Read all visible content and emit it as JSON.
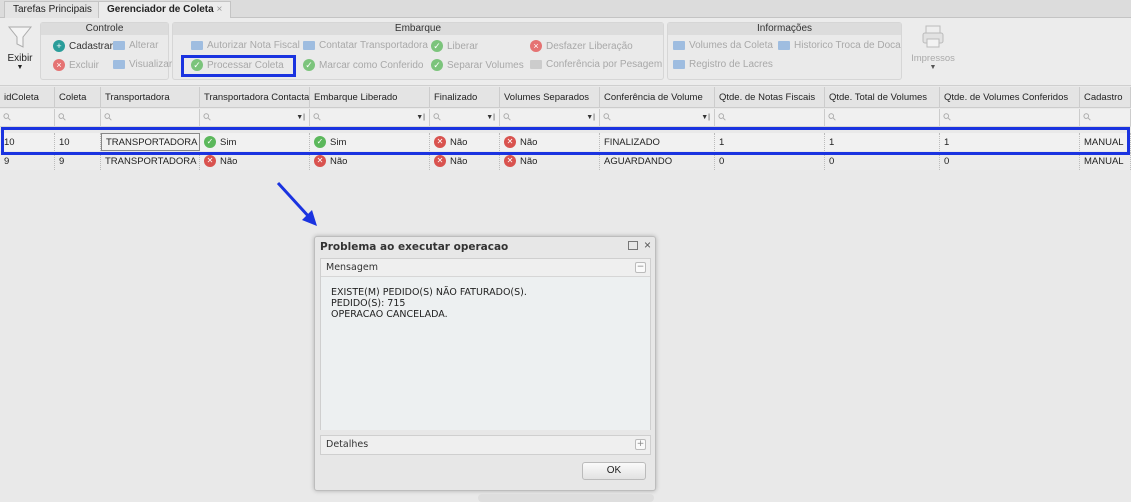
{
  "tabs": [
    {
      "label": "Tarefas Principais"
    },
    {
      "label": "Gerenciador de Coleta",
      "close": "×"
    }
  ],
  "ribbon": {
    "exibir": "Exibir",
    "controle": {
      "title": "Controle",
      "cadastrar": "Cadastrar",
      "alterar": "Alterar",
      "excluir": "Excluir",
      "visualizar": "Visualizar"
    },
    "embarque": {
      "title": "Embarque",
      "autorizar": "Autorizar Nota Fiscal",
      "contatar": "Contatar Transportadora",
      "liberar": "Liberar",
      "desfazer": "Desfazer Liberação",
      "processar": "Processar Coleta",
      "marcar": "Marcar como Conferido",
      "separar": "Separar Volumes",
      "conferencia": "Conferência por Pesagem"
    },
    "informacoes": {
      "title": "Informações",
      "volumes": "Volumes da Coleta",
      "historico": "Historico Troca de Doca",
      "lacres": "Registro de Lacres"
    },
    "impressos": "Impressos"
  },
  "columns": [
    "idColeta",
    "Coleta",
    "Transportadora",
    "Transportadora Contactada",
    "Embarque Liberado",
    "Finalizado",
    "Volumes Separados",
    "Conferência de Volume",
    "Qtde. de Notas Fiscais",
    "Qtde. Total de Volumes",
    "Qtde. de Volumes Conferidos",
    "Cadastro"
  ],
  "rows": [
    [
      "10",
      "10",
      "TRANSPORTADORA",
      "Sim",
      "Sim",
      "Não",
      "Não",
      "FINALIZADO",
      "1",
      "1",
      "1",
      "MANUAL"
    ],
    [
      "9",
      "9",
      "TRANSPORTADORA",
      "Não",
      "Não",
      "Não",
      "Não",
      "AGUARDANDO",
      "0",
      "0",
      "0",
      "MANUAL"
    ]
  ],
  "dialog": {
    "title": "Problema ao executar operacao",
    "mensagem": "Mensagem",
    "lines": [
      "EXISTE(M) PEDIDO(S) NÃO FATURADO(S).",
      "PEDIDO(S): 715",
      "OPERACAO CANCELADA."
    ],
    "detalhes": "Detalhes",
    "ok": "OK"
  },
  "colors": {
    "highlight": "#1a33e0",
    "ok": "#5cb85c",
    "no": "#d9534f"
  }
}
